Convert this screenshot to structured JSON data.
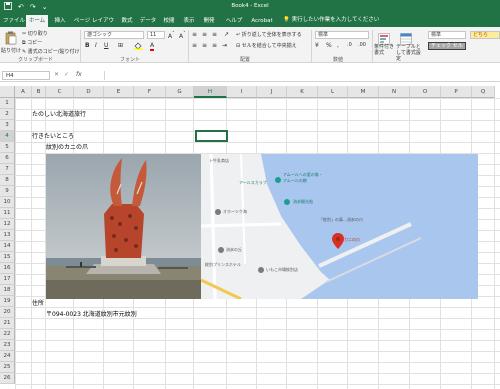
{
  "window": {
    "title": "Book4 - Excel"
  },
  "quick_access": {
    "save_icon": "save-icon",
    "undo_icon": "undo-icon",
    "redo_icon": "redo-icon"
  },
  "tabs": [
    "ファイル",
    "ホーム",
    "挿入",
    "ページ レイアウト",
    "数式",
    "データ",
    "校閲",
    "表示",
    "開発",
    "ヘルプ",
    "Acrobat"
  ],
  "active_tab": "ホーム",
  "tell_me": "実行したい作業を入力してください",
  "ribbon": {
    "clipboard": {
      "paste": "貼り付け",
      "cut": "切り取り",
      "copy": "コピー",
      "format_painter": "書式のコピー/貼り付け",
      "label": "クリップボード"
    },
    "font": {
      "name": "游ゴシック",
      "size": "11",
      "label": "フォント"
    },
    "alignment": {
      "wrap": "折り返して全体を表示する",
      "merge": "セルを結合して中央揃え",
      "label": "配置"
    },
    "number": {
      "format": "標準",
      "label": "数値"
    },
    "styles": {
      "conditional": "条件付き書式",
      "table": "テーブルとして書式設定",
      "style_normal": "標準",
      "style_check": "チェック セル",
      "style_bad": "どちら"
    }
  },
  "formula_bar": {
    "name_box": "H4",
    "fx": "fx"
  },
  "columns": [
    "A",
    "B",
    "C",
    "D",
    "E",
    "F",
    "G",
    "H",
    "I",
    "J",
    "K",
    "L",
    "M",
    "N",
    "O",
    "P",
    "Q"
  ],
  "rows": [
    "1",
    "2",
    "3",
    "4",
    "5",
    "6",
    "7",
    "8",
    "9",
    "10",
    "11",
    "12",
    "13",
    "14",
    "15",
    "16",
    "17",
    "18",
    "19",
    "20",
    "21",
    "22",
    "23",
    "24",
    "25",
    "26"
  ],
  "cells": {
    "b2": "たのしい北海道旅行",
    "b4": "行きたいところ",
    "c5": "紋別のカニの爪",
    "b20": "住所",
    "c21": "〒094-0023 北海道紋別市元紋別"
  },
  "map_labels": {
    "l1": "ト牛乳商店",
    "l2": "アールスカラブ",
    "l3": "アムールへの愛の像・",
    "l4": "アムールの棚",
    "l5": "流氷観光船",
    "l6": "オホーツク海",
    "l7": "流氷の丘",
    "l8": "カニの爪",
    "l9": "紋別プリンスホテル",
    "l10": "いもこ市場紋別店",
    "l11": "「紋別」の真…流氷の爪"
  },
  "colors": {
    "excel_green": "#217346",
    "water": "#a9c7ee",
    "land": "#eef0f2",
    "pin": "#d93025"
  }
}
